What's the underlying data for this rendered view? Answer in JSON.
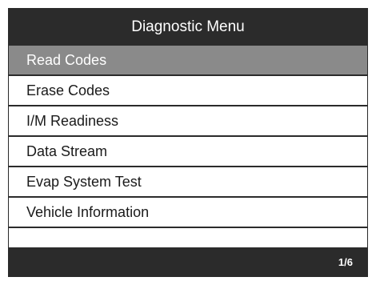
{
  "header": {
    "title": "Diagnostic Menu"
  },
  "menu": {
    "items": [
      {
        "label": "Read Codes",
        "selected": true
      },
      {
        "label": "Erase Codes",
        "selected": false
      },
      {
        "label": "I/M Readiness",
        "selected": false
      },
      {
        "label": "Data Stream",
        "selected": false
      },
      {
        "label": "Evap System Test",
        "selected": false
      },
      {
        "label": "Vehicle Information",
        "selected": false
      }
    ]
  },
  "footer": {
    "page_indicator": "1/6"
  },
  "colors": {
    "bar_background": "#2b2b2b",
    "selected_background": "#8a8a8a",
    "item_background": "#ffffff"
  }
}
